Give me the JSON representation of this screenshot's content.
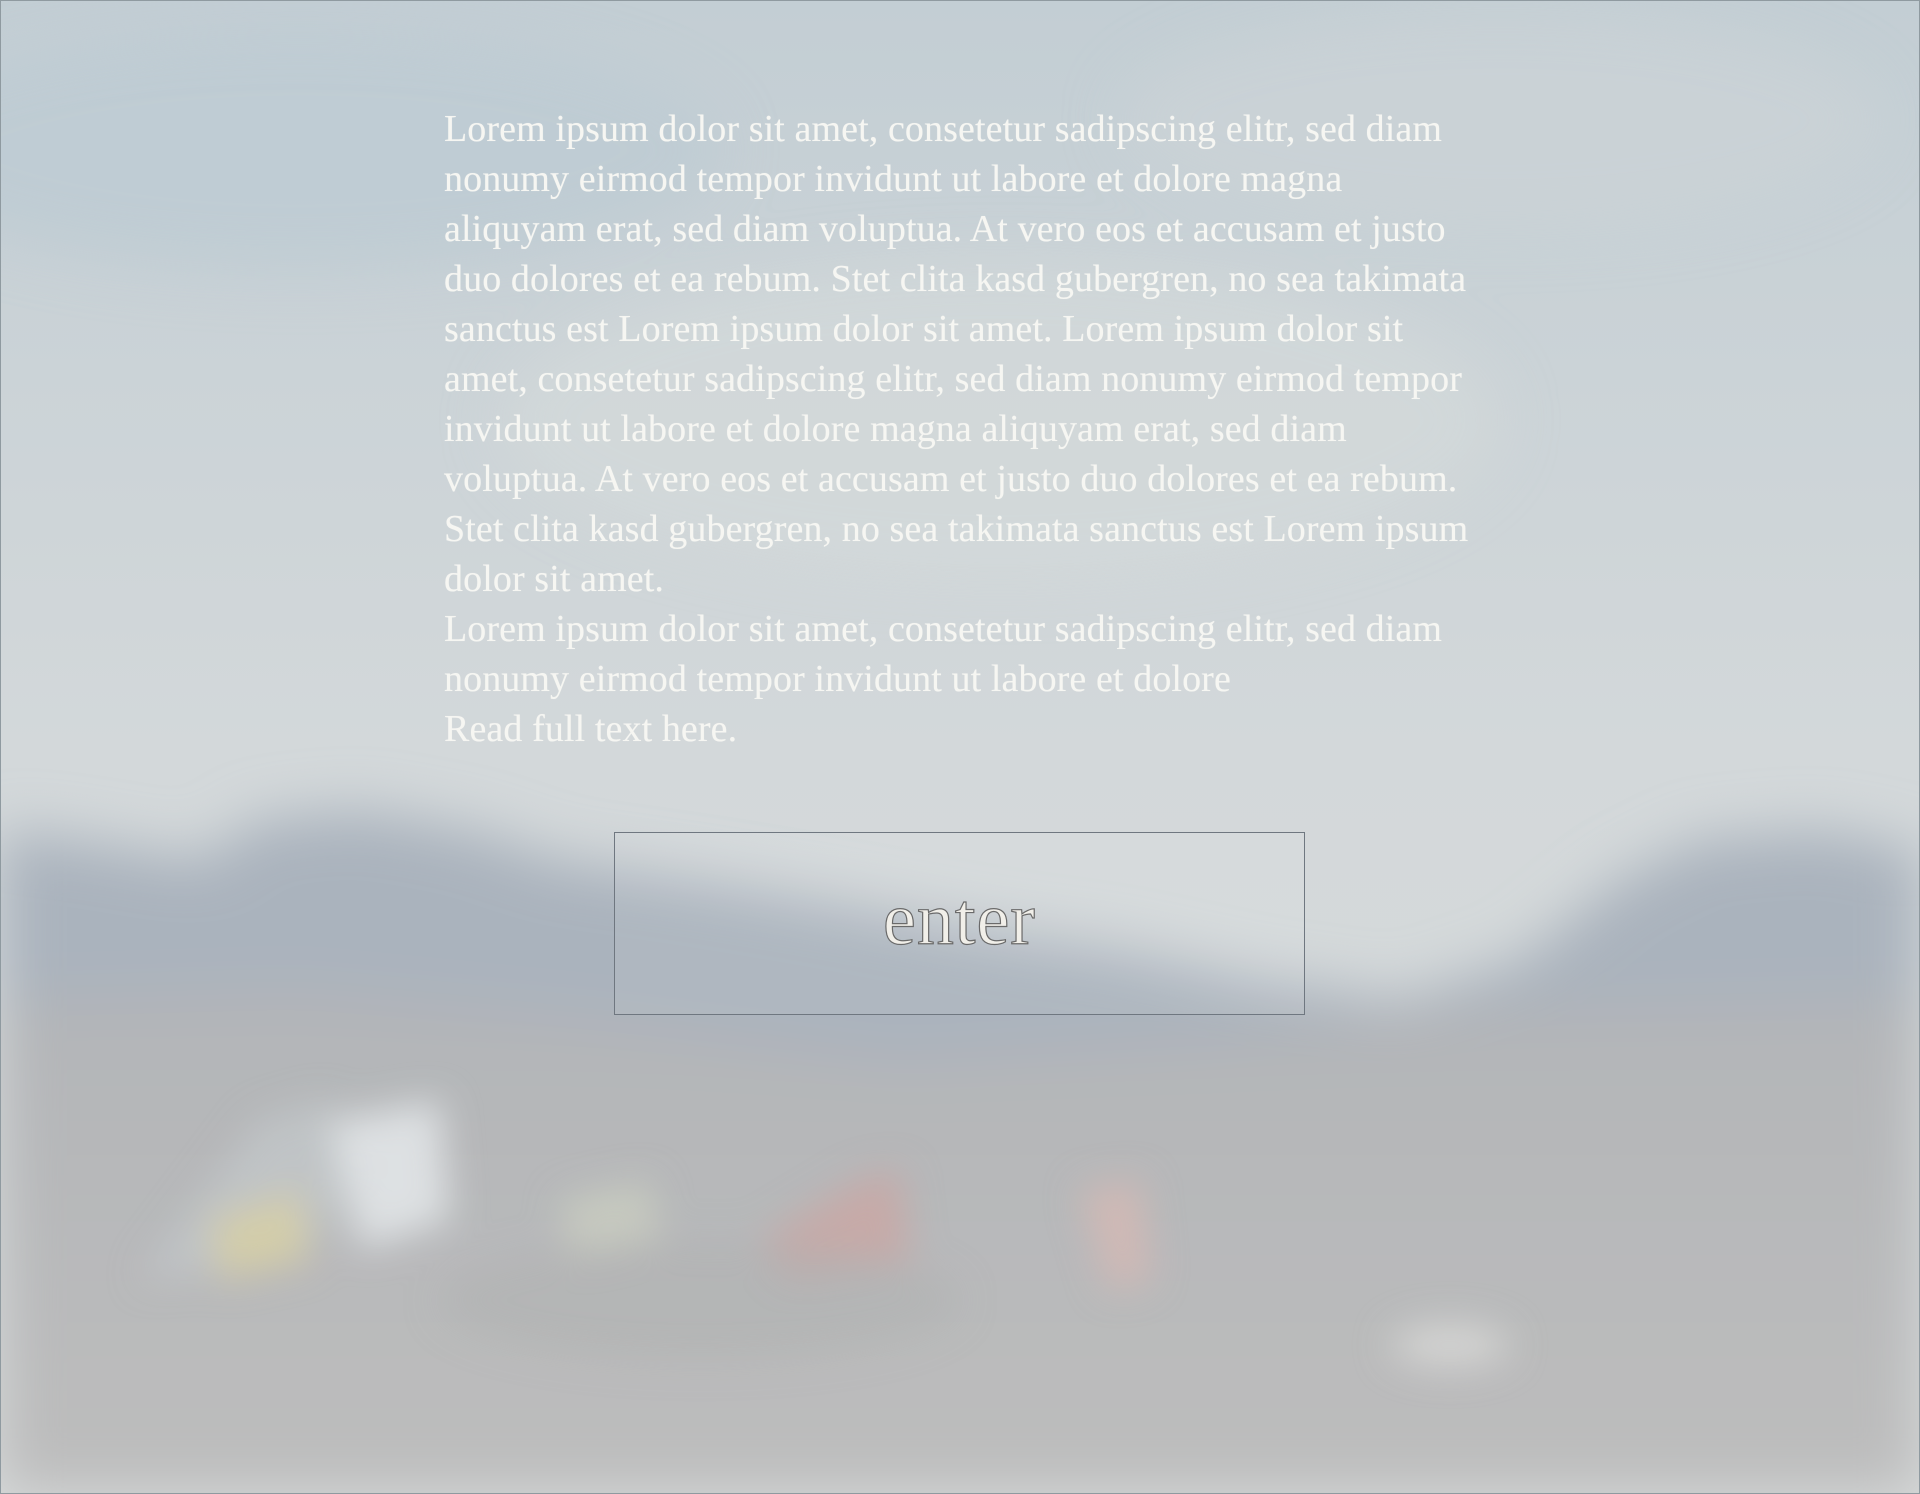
{
  "intro": {
    "paragraph_1": "Lorem ipsum dolor sit amet, consetetur sadipscing elitr, sed diam nonumy eirmod tempor invidunt ut labore et dolore magna aliquyam erat, sed diam voluptua. At vero eos et accusam et justo duo dolores et ea rebum. Stet clita kasd gubergren, no sea takimata sanctus est Lorem ipsum dolor sit amet. Lorem ipsum dolor sit amet, consetetur sadipscing elitr, sed diam nonumy eirmod tempor invidunt ut labore et dolore magna aliquyam erat, sed diam voluptua. At vero eos et accusam et justo duo dolores et ea rebum. Stet clita kasd gubergren, no sea takimata sanctus est Lorem ipsum dolor sit amet.",
    "paragraph_2": "Lorem ipsum dolor sit amet, consetetur sadipscing elitr, sed diam nonumy eirmod tempor invidunt ut labore et dolore",
    "read_more_label": "Read full text here."
  },
  "enter_button": {
    "label": "enter"
  },
  "background": {
    "sky_color": "#c6d0d5",
    "mountain_color": "#a9b2bb",
    "ground_color": "#b8b8b8",
    "flag_colors": [
      "#d9d2a6",
      "#e7ebef",
      "#c7a5a3",
      "#d2b7b2"
    ]
  }
}
